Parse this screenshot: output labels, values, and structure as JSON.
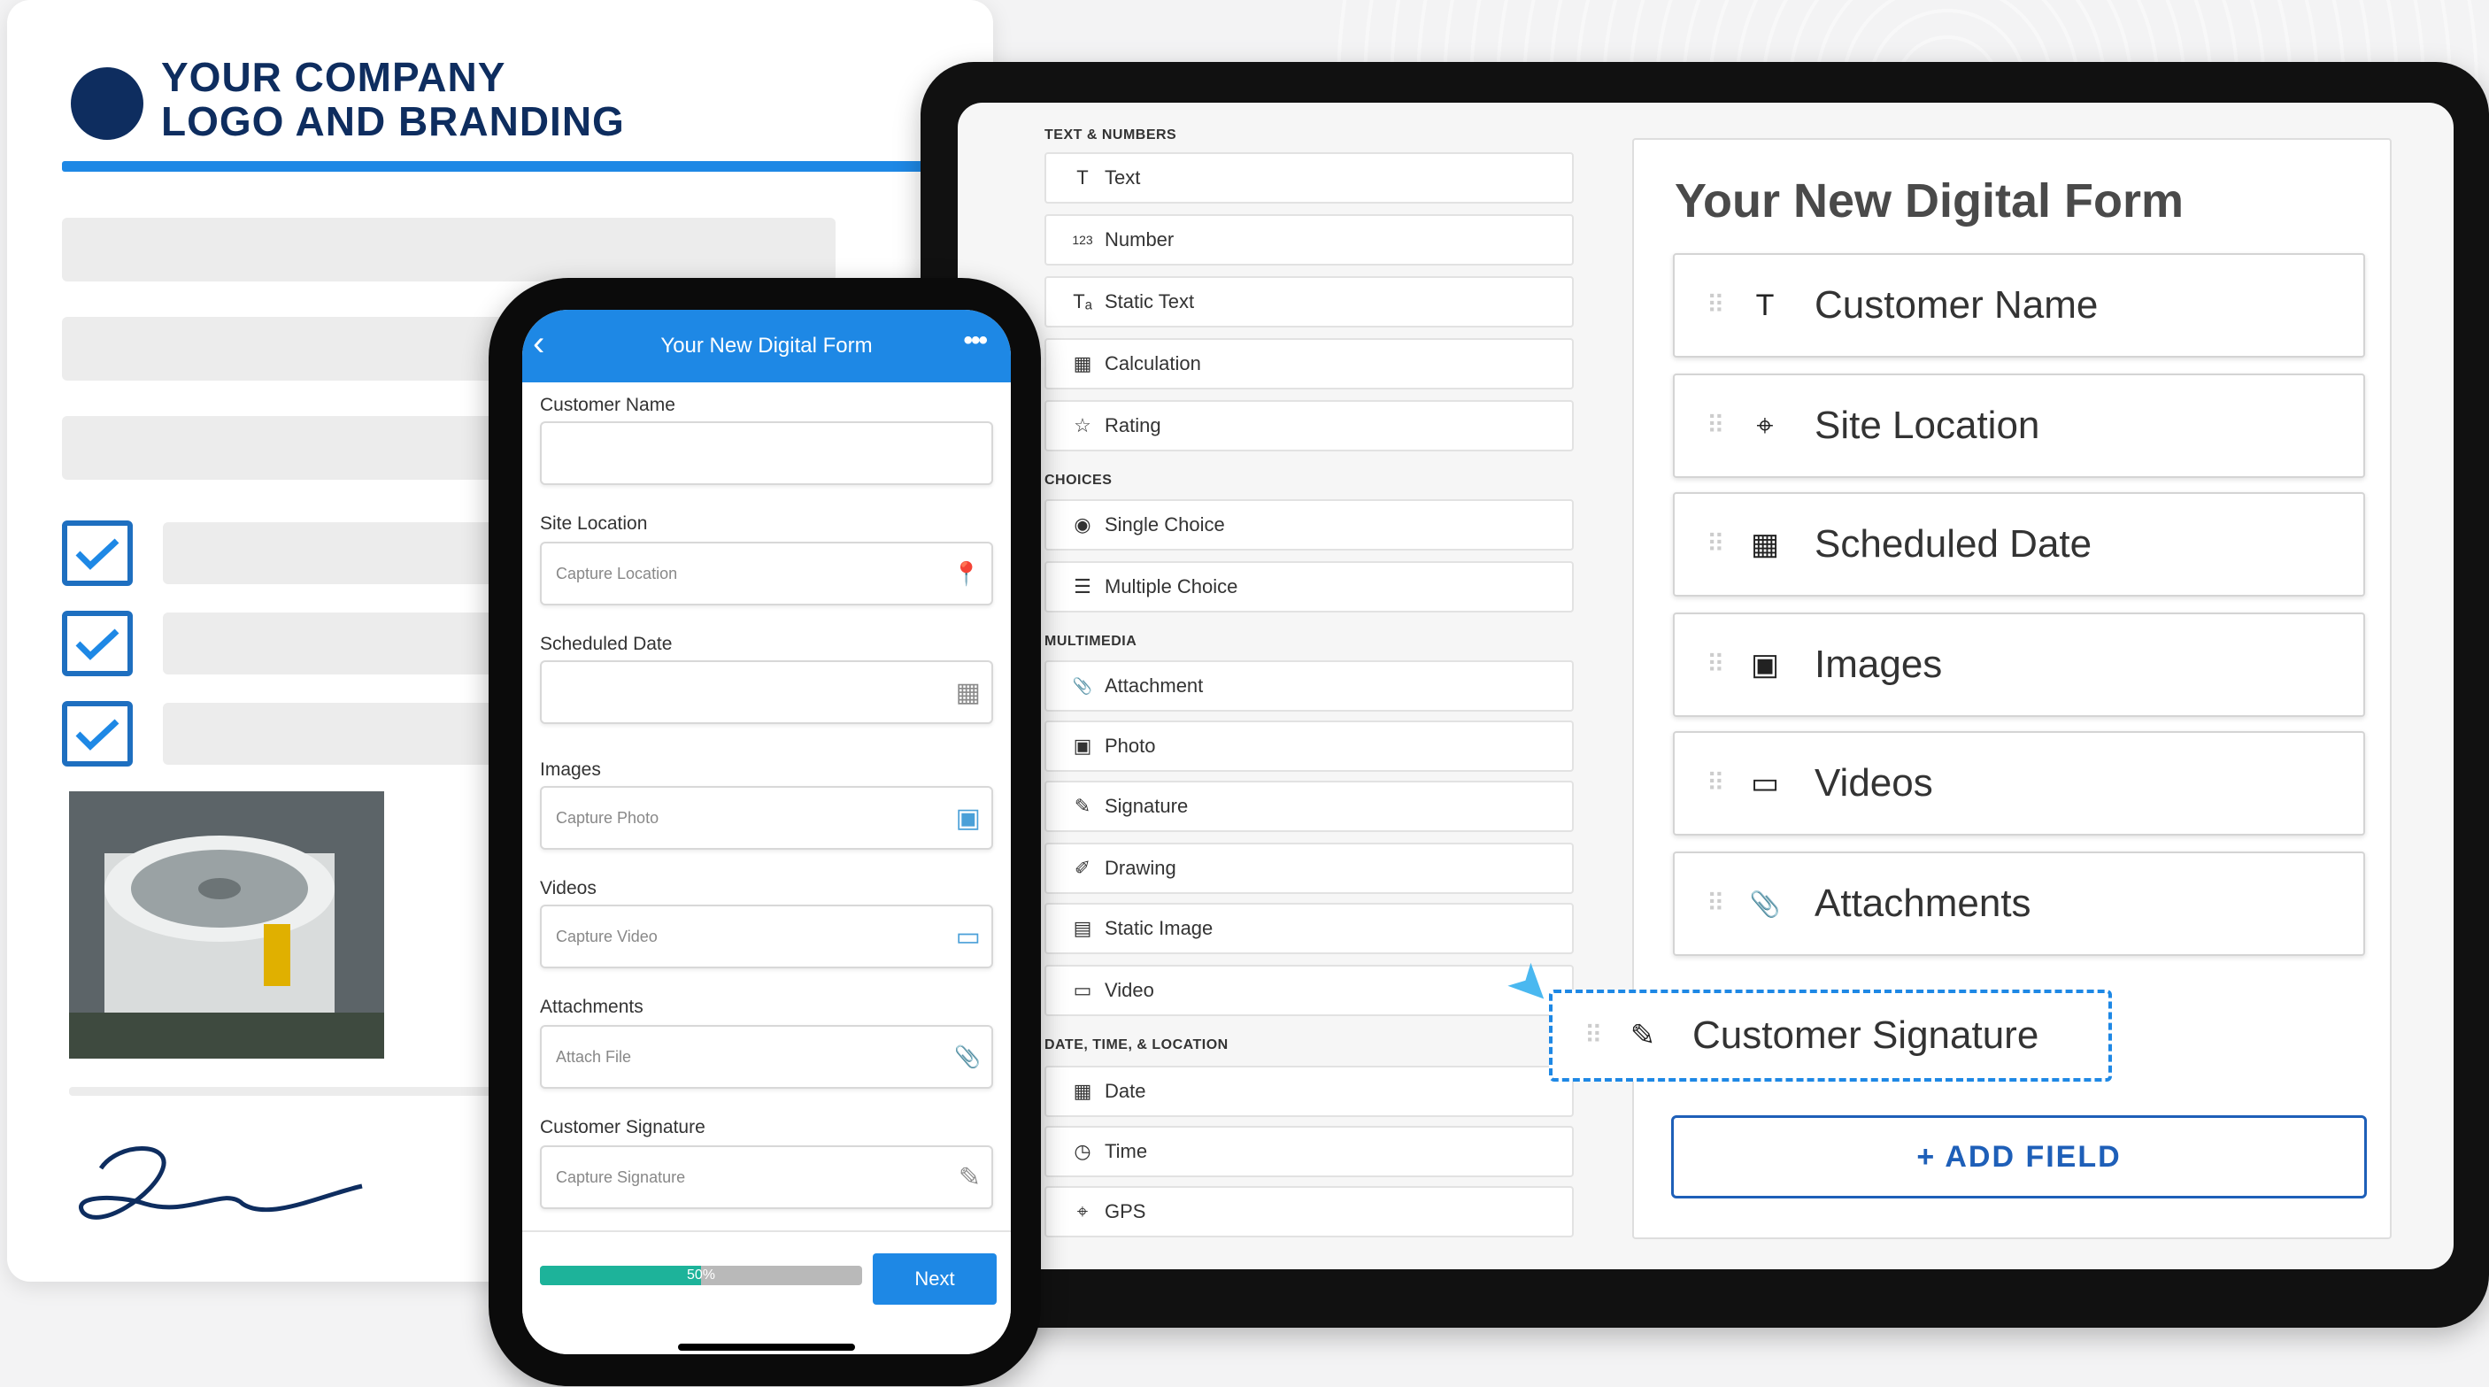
{
  "document": {
    "logo_line1": "YOUR COMPANY",
    "logo_line2": "LOGO AND BRANDING"
  },
  "tablet": {
    "palette": {
      "sections": [
        {
          "title": "TEXT & NUMBERS",
          "items": [
            {
              "label": "Text",
              "icon": "T"
            },
            {
              "label": "Number",
              "icon": "123"
            },
            {
              "label": "Static Text",
              "icon": "Tₐ"
            },
            {
              "label": "Calculation",
              "icon": "▦"
            },
            {
              "label": "Rating",
              "icon": "☆"
            }
          ]
        },
        {
          "title": "CHOICES",
          "items": [
            {
              "label": "Single Choice",
              "icon": "◉"
            },
            {
              "label": "Multiple Choice",
              "icon": "☰"
            }
          ]
        },
        {
          "title": "MULTIMEDIA",
          "items": [
            {
              "label": "Attachment",
              "icon": "📎"
            },
            {
              "label": "Photo",
              "icon": "▣"
            },
            {
              "label": "Signature",
              "icon": "✎"
            },
            {
              "label": "Drawing",
              "icon": "✐"
            },
            {
              "label": "Static Image",
              "icon": "▤"
            },
            {
              "label": "Video",
              "icon": "▭"
            }
          ]
        },
        {
          "title": "DATE, TIME, & LOCATION",
          "items": [
            {
              "label": "Date",
              "icon": "▦"
            },
            {
              "label": "Time",
              "icon": "◷"
            },
            {
              "label": "GPS",
              "icon": "⌖"
            }
          ]
        }
      ]
    },
    "form": {
      "title": "Your New Digital Form",
      "fields": [
        {
          "label": "Customer Name",
          "icon": "T"
        },
        {
          "label": "Site Location",
          "icon": "⌖"
        },
        {
          "label": "Scheduled Date",
          "icon": "▦"
        },
        {
          "label": "Images",
          "icon": "▣"
        },
        {
          "label": "Videos",
          "icon": "▭"
        },
        {
          "label": "Attachments",
          "icon": "📎"
        }
      ],
      "dragging_field": {
        "label": "Customer Signature",
        "icon": "✎"
      },
      "add_field": "+ ADD FIELD"
    }
  },
  "phone": {
    "title": "Your New Digital Form",
    "fields": [
      {
        "label": "Customer Name",
        "placeholder": "",
        "icon": ""
      },
      {
        "label": "Site Location",
        "placeholder": "Capture Location",
        "icon": "📍"
      },
      {
        "label": "Scheduled Date",
        "placeholder": "",
        "icon": "▦"
      },
      {
        "label": "Images",
        "placeholder": "Capture Photo",
        "icon": "▣"
      },
      {
        "label": "Videos",
        "placeholder": "Capture Video",
        "icon": "▭"
      },
      {
        "label": "Attachments",
        "placeholder": "Attach File",
        "icon": "📎"
      },
      {
        "label": "Customer Signature",
        "placeholder": "Capture Signature",
        "icon": "✎"
      }
    ],
    "progress_label": "50%",
    "progress_fraction": 0.5,
    "next": "Next"
  },
  "colors": {
    "brand_navy": "#0e2d5f",
    "accent_blue": "#1e88e5",
    "progress_green": "#1db39a"
  }
}
